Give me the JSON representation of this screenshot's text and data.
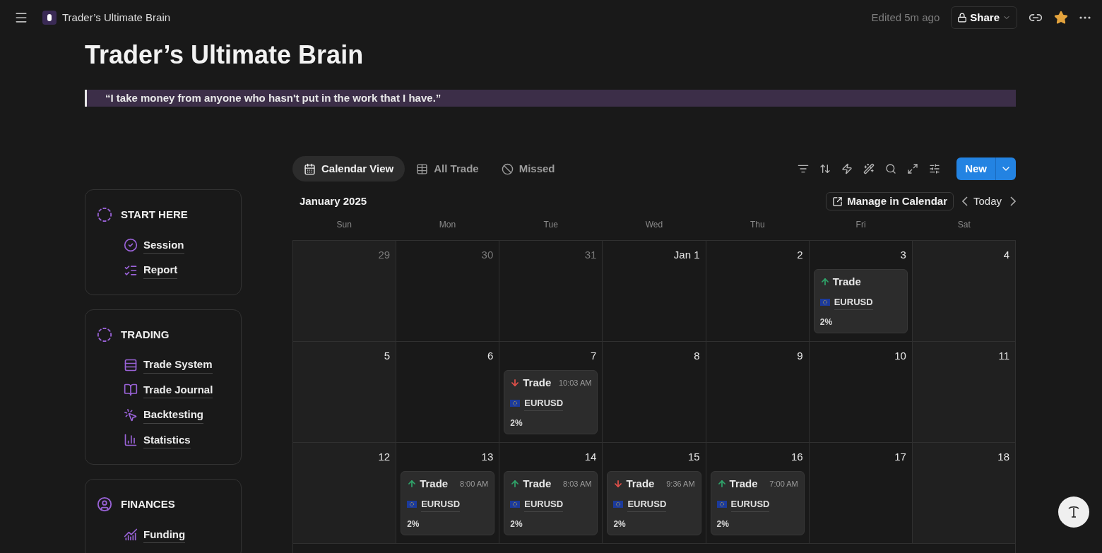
{
  "topbar": {
    "breadcrumb": "Trader’s Ultimate Brain",
    "edited": "Edited 5m ago",
    "share": "Share",
    "favorited": true
  },
  "title": "Trader’s Ultimate Brain",
  "quote": "“I take money from anyone who hasn't put in the work that I have.”",
  "sidebar": [
    {
      "title": "START HERE",
      "items": [
        {
          "label": "Session"
        },
        {
          "label": "Report"
        }
      ]
    },
    {
      "title": "TRADING",
      "items": [
        {
          "label": "Trade System"
        },
        {
          "label": "Trade Journal"
        },
        {
          "label": "Backtesting"
        },
        {
          "label": "Statistics"
        }
      ]
    },
    {
      "title": "FINANCES",
      "items": [
        {
          "label": "Funding"
        }
      ]
    }
  ],
  "tabs": [
    {
      "label": "Calendar View",
      "selected": true
    },
    {
      "label": "All Trade",
      "selected": false
    },
    {
      "label": "Missed",
      "selected": false
    }
  ],
  "new_button": "New",
  "calendar": {
    "month": "January 2025",
    "manage": "Manage in Calendar",
    "today": "Today",
    "weekdays": [
      "Sun",
      "Mon",
      "Tue",
      "Wed",
      "Thu",
      "Fri",
      "Sat"
    ],
    "weeks": [
      [
        {
          "day": "29",
          "outside": true
        },
        {
          "day": "30",
          "outside": true
        },
        {
          "day": "31",
          "outside": true
        },
        {
          "day": "Jan 1",
          "outside": false
        },
        {
          "day": "2",
          "outside": false
        },
        {
          "day": "3",
          "outside": false,
          "trades": [
            {
              "kind": "up",
              "title": "Trade",
              "pair": "EURUSD",
              "risk": "2%"
            }
          ]
        },
        {
          "day": "4",
          "outside": false
        }
      ],
      [
        {
          "day": "5",
          "outside": false
        },
        {
          "day": "6",
          "outside": false
        },
        {
          "day": "7",
          "outside": false,
          "trades": [
            {
              "kind": "down",
              "title": "Trade",
              "time": "10:03 AM",
              "pair": "EURUSD",
              "risk": "2%"
            }
          ]
        },
        {
          "day": "8",
          "outside": false
        },
        {
          "day": "9",
          "outside": false
        },
        {
          "day": "10",
          "outside": false
        },
        {
          "day": "11",
          "outside": false
        }
      ],
      [
        {
          "day": "12",
          "outside": false
        },
        {
          "day": "13",
          "outside": false,
          "trades": [
            {
              "kind": "up",
              "title": "Trade",
              "time": "8:00 AM",
              "pair": "EURUSD",
              "risk": "2%"
            }
          ]
        },
        {
          "day": "14",
          "outside": false,
          "trades": [
            {
              "kind": "up",
              "title": "Trade",
              "time": "8:03 AM",
              "pair": "EURUSD",
              "risk": "2%"
            }
          ]
        },
        {
          "day": "15",
          "outside": false,
          "trades": [
            {
              "kind": "down",
              "title": "Trade",
              "time": "9:36 AM",
              "pair": "EURUSD",
              "risk": "2%"
            }
          ]
        },
        {
          "day": "16",
          "outside": false,
          "trades": [
            {
              "kind": "up",
              "title": "Trade",
              "time": "7:00 AM",
              "pair": "EURUSD",
              "risk": "2%"
            }
          ]
        },
        {
          "day": "17",
          "outside": false
        },
        {
          "day": "18",
          "outside": false
        }
      ]
    ]
  }
}
